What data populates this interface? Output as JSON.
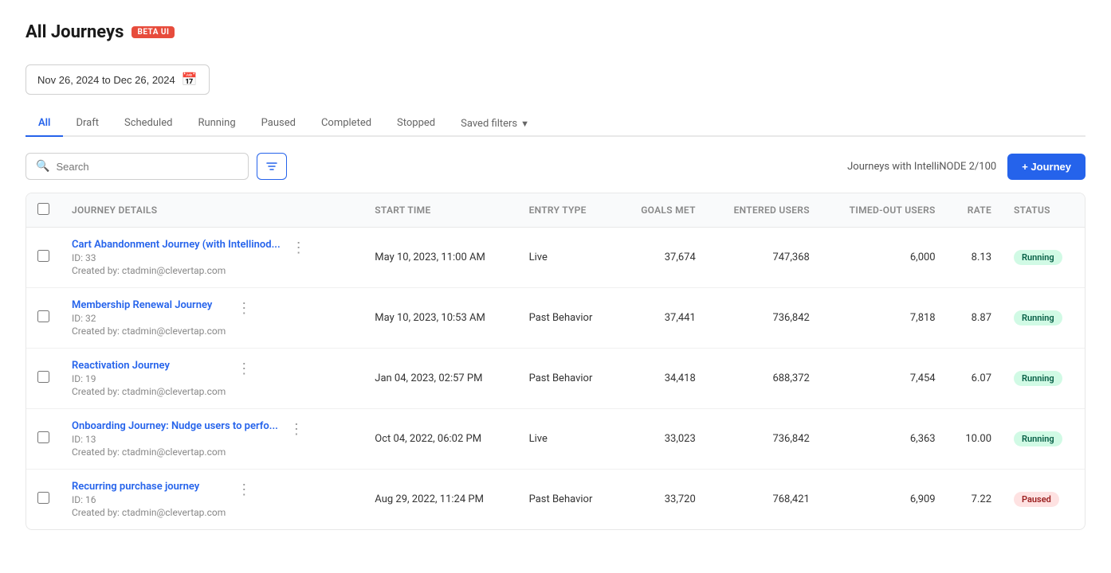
{
  "page": {
    "title": "All Journeys",
    "beta_badge": "BETA UI"
  },
  "date_range": {
    "label": "Nov 26, 2024 to Dec 26, 2024"
  },
  "tabs": [
    {
      "id": "all",
      "label": "All",
      "active": true
    },
    {
      "id": "draft",
      "label": "Draft",
      "active": false
    },
    {
      "id": "scheduled",
      "label": "Scheduled",
      "active": false
    },
    {
      "id": "running",
      "label": "Running",
      "active": false
    },
    {
      "id": "paused",
      "label": "Paused",
      "active": false
    },
    {
      "id": "completed",
      "label": "Completed",
      "active": false
    },
    {
      "id": "stopped",
      "label": "Stopped",
      "active": false
    }
  ],
  "saved_filters": {
    "label": "Saved filters"
  },
  "toolbar": {
    "search_placeholder": "Search",
    "intellinode_info": "Journeys with IntelliNODE 2/100",
    "add_journey_label": "+ Journey"
  },
  "table": {
    "headers": [
      {
        "id": "details",
        "label": "Journey Details"
      },
      {
        "id": "start_time",
        "label": "Start Time"
      },
      {
        "id": "entry_type",
        "label": "Entry Type"
      },
      {
        "id": "goals_met",
        "label": "Goals Met",
        "numeric": true
      },
      {
        "id": "entered_users",
        "label": "Entered Users",
        "numeric": true
      },
      {
        "id": "timed_out_users",
        "label": "Timed-Out Users",
        "numeric": true
      },
      {
        "id": "rate",
        "label": "Rate",
        "numeric": true
      },
      {
        "id": "status",
        "label": "Status"
      }
    ],
    "rows": [
      {
        "id": 1,
        "name": "Cart Abandonment Journey (with Intellinod...",
        "journey_id": "ID: 33",
        "created_by": "Created by: ctadmin@clevertap.com",
        "start_time": "May 10, 2023, 11:00 AM",
        "entry_type": "Live",
        "goals_met": "37,674",
        "entered_users": "747,368",
        "timed_out_users": "6,000",
        "rate": "8.13",
        "status": "Running",
        "status_class": "status-running"
      },
      {
        "id": 2,
        "name": "Membership Renewal Journey",
        "journey_id": "ID: 32",
        "created_by": "Created by: ctadmin@clevertap.com",
        "start_time": "May 10, 2023, 10:53 AM",
        "entry_type": "Past Behavior",
        "goals_met": "37,441",
        "entered_users": "736,842",
        "timed_out_users": "7,818",
        "rate": "8.87",
        "status": "Running",
        "status_class": "status-running"
      },
      {
        "id": 3,
        "name": "Reactivation Journey",
        "journey_id": "ID: 19",
        "created_by": "Created by: ctadmin@clevertap.com",
        "start_time": "Jan 04, 2023, 02:57 PM",
        "entry_type": "Past Behavior",
        "goals_met": "34,418",
        "entered_users": "688,372",
        "timed_out_users": "7,454",
        "rate": "6.07",
        "status": "Running",
        "status_class": "status-running"
      },
      {
        "id": 4,
        "name": "Onboarding Journey: Nudge users to perfo...",
        "journey_id": "ID: 13",
        "created_by": "Created by: ctadmin@clevertap.com",
        "start_time": "Oct 04, 2022, 06:02 PM",
        "entry_type": "Live",
        "goals_met": "33,023",
        "entered_users": "736,842",
        "timed_out_users": "6,363",
        "rate": "10.00",
        "status": "Running",
        "status_class": "status-running"
      },
      {
        "id": 5,
        "name": "Recurring purchase journey",
        "journey_id": "ID: 16",
        "created_by": "Created by: ctadmin@clevertap.com",
        "start_time": "Aug 29, 2022, 11:24 PM",
        "entry_type": "Past Behavior",
        "goals_met": "33,720",
        "entered_users": "768,421",
        "timed_out_users": "6,909",
        "rate": "7.22",
        "status": "Paused",
        "status_class": "status-paused"
      }
    ]
  }
}
